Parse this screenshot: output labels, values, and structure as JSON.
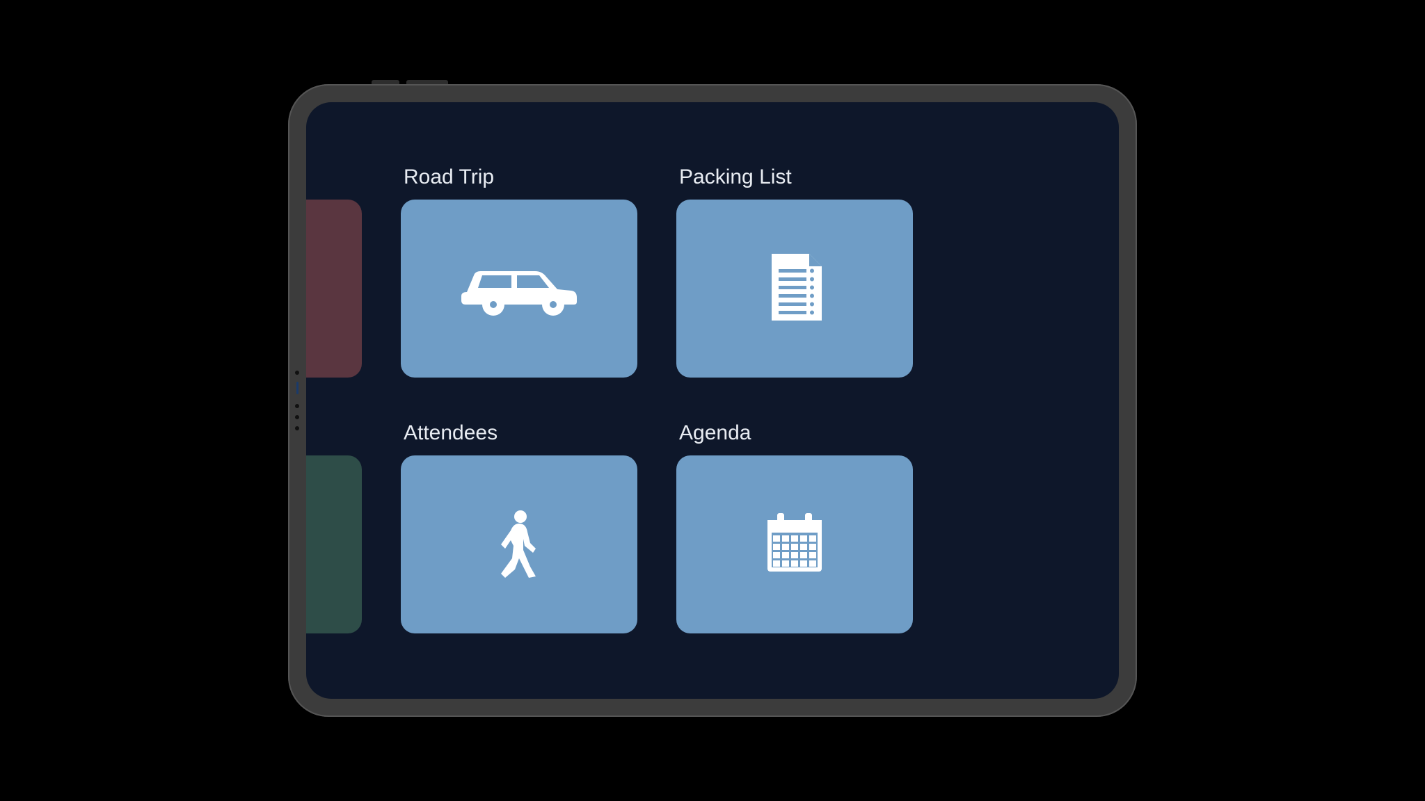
{
  "tiles": {
    "road_trip": {
      "label": "Road Trip",
      "icon": "car-icon",
      "color": "#6f9dc6"
    },
    "packing_list": {
      "label": "Packing List",
      "icon": "list-icon",
      "color": "#6f9dc6"
    },
    "attendees": {
      "label": "Attendees",
      "icon": "person-icon",
      "color": "#6f9dc6"
    },
    "agenda": {
      "label": "Agenda",
      "icon": "calendar-icon",
      "color": "#6f9dc6"
    },
    "partial_top": {
      "label": "",
      "icon": "",
      "color": "#5a3640"
    },
    "partial_bottom": {
      "label": "",
      "icon": "",
      "color": "#2e4d48"
    }
  }
}
